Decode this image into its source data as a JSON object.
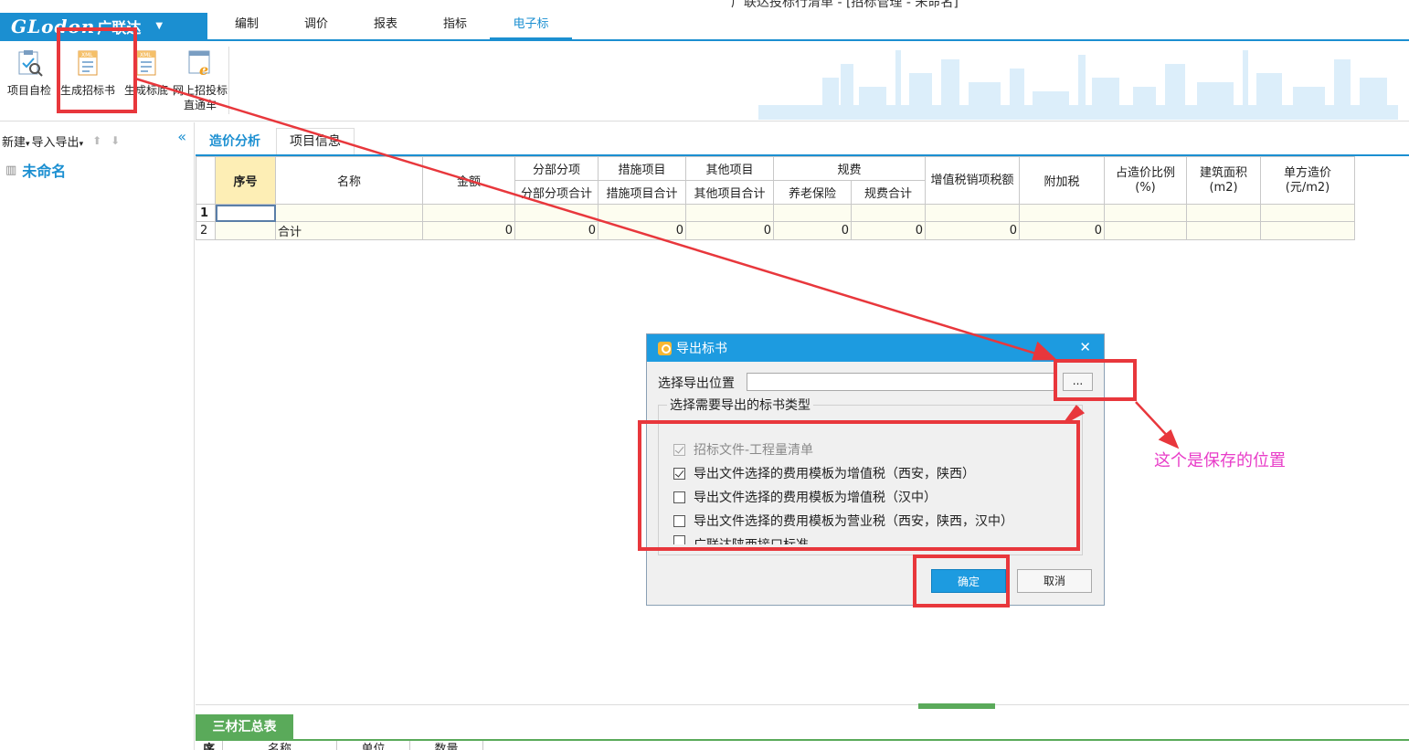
{
  "title_partial": "广联达投标行清单 - [招标管理 - 未命名]",
  "app": {
    "brand": "GLodon",
    "brand_cn": "广联达",
    "dropdown_icon": "chevron-down-icon"
  },
  "menu_tabs": [
    "编制",
    "调价",
    "报表",
    "指标",
    "电子标"
  ],
  "ribbon": [
    {
      "label": "项目自检",
      "icon": "project-check-icon"
    },
    {
      "label": "生成招标书",
      "icon": "xml-document-icon"
    },
    {
      "label": "生成标底",
      "icon": "xml-document-icon"
    },
    {
      "label": "网上招投标直通车",
      "icon": "ie-browser-icon"
    }
  ],
  "left_panel": {
    "new_label": "新建",
    "import_export_label": "导入导出",
    "tree_item": "未命名"
  },
  "content_tabs": [
    "造价分析",
    "项目信息"
  ],
  "grid": {
    "headers": {
      "seq": "序号",
      "name": "名称",
      "amount": "金额",
      "fbfx": "分部分项",
      "fbfx_total": "分部分项合计",
      "csxm": "措施项目",
      "csxm_total": "措施项目合计",
      "qtxm": "其他项目",
      "qtxm_total": "其他项目合计",
      "gf": "规费",
      "ylbx": "养老保险",
      "gf_total": "规费合计",
      "zzs": "增值税销项税额",
      "fjs": "附加税",
      "zzj": "占造价比例(%)",
      "jzmj": "建筑面积(m2)",
      "dfzj": "单方造价(元/m2)"
    },
    "rows": [
      {
        "rownum": "1",
        "seq": "",
        "name": "",
        "amount": "",
        "fbfx": "",
        "csxm": "",
        "qtxm": "",
        "ylbx": "",
        "gf": "",
        "zzs": "",
        "fjs": "",
        "zzj": "",
        "jzmj": "",
        "dfzj": ""
      },
      {
        "rownum": "2",
        "seq": "",
        "name": "合计",
        "amount": "0",
        "fbfx": "0",
        "csxm": "0",
        "qtxm": "0",
        "ylbx": "0",
        "gf": "0",
        "zzs": "0",
        "fjs": "0",
        "zzj": "",
        "jzmj": "",
        "dfzj": ""
      }
    ]
  },
  "bottom": {
    "tab": "三材汇总表",
    "headers": [
      "序",
      "名称",
      "单位",
      "数量"
    ]
  },
  "dialog": {
    "title": "导出标书",
    "location_label": "选择导出位置",
    "location_value": "",
    "browse_label": "...",
    "group_label": "选择需要导出的标书类型",
    "options": [
      {
        "label": "招标文件-工程量清单",
        "checked": true,
        "disabled": true
      },
      {
        "label": "导出文件选择的费用模板为增值税（西安，陕西）",
        "checked": true,
        "disabled": false
      },
      {
        "label": "导出文件选择的费用模板为增值税（汉中）",
        "checked": false,
        "disabled": false
      },
      {
        "label": "导出文件选择的费用模板为营业税（西安，陕西，汉中）",
        "checked": false,
        "disabled": false
      },
      {
        "label": "广联达陕西接口标准",
        "checked": false,
        "disabled": false
      }
    ],
    "ok_label": "确定",
    "cancel_label": "取消"
  },
  "annotation": {
    "text": "这个是保存的位置",
    "color": "#e83cc8",
    "box_color": "#e8373c"
  },
  "colors": {
    "accent": "#1b8fd1",
    "dialog_title": "#1d9be0",
    "green_tab": "#5aaa5a",
    "header_highlight": "#fdeeb5"
  }
}
